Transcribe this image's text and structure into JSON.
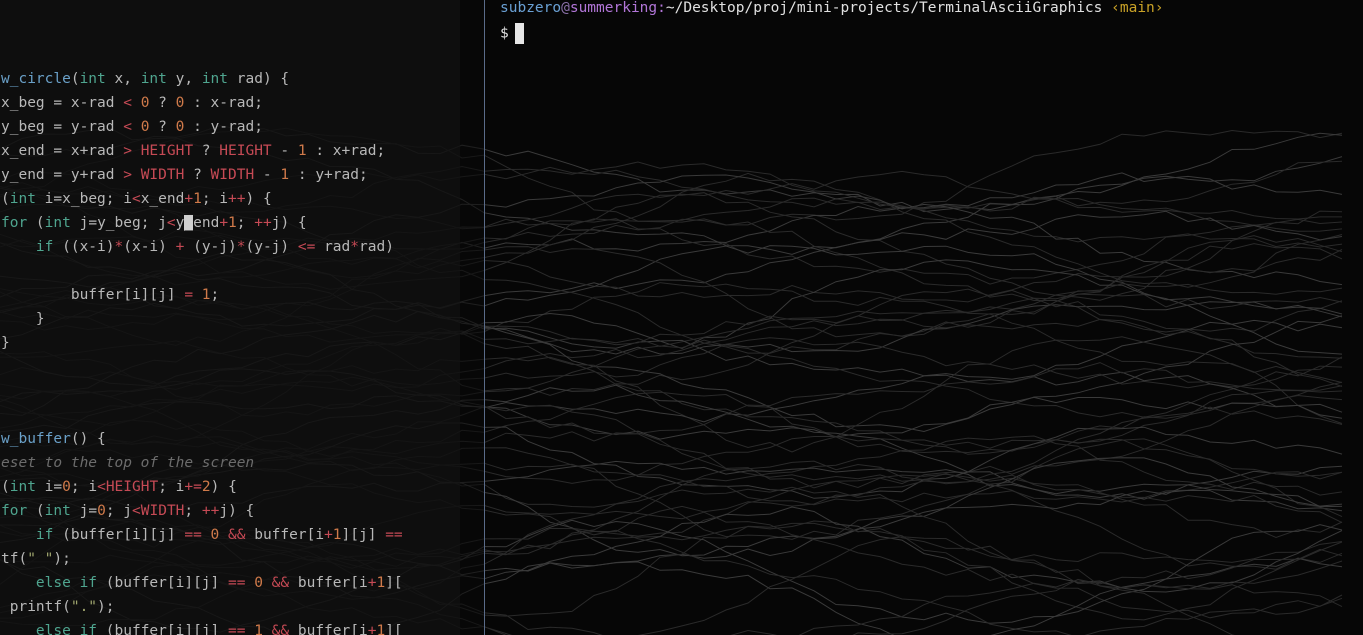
{
  "editor": {
    "lines": [
      [
        [
          "f",
          "w_circle"
        ],
        [
          "p",
          "("
        ],
        [
          "k",
          "int"
        ],
        [
          "p",
          " x, "
        ],
        [
          "k",
          "int"
        ],
        [
          "p",
          " y, "
        ],
        [
          "k",
          "int"
        ],
        [
          "p",
          " rad) {"
        ]
      ],
      [
        [
          "p",
          "x_beg = x-rad "
        ],
        [
          "o",
          "<"
        ],
        [
          "p",
          " "
        ],
        [
          "n",
          "0"
        ],
        [
          "p",
          " ? "
        ],
        [
          "n",
          "0"
        ],
        [
          "p",
          " : x-rad;"
        ]
      ],
      [
        [
          "p",
          "y_beg = y-rad "
        ],
        [
          "o",
          "<"
        ],
        [
          "p",
          " "
        ],
        [
          "n",
          "0"
        ],
        [
          "p",
          " ? "
        ],
        [
          "n",
          "0"
        ],
        [
          "p",
          " : y-rad;"
        ]
      ],
      [
        [
          "p",
          "x_end = x+rad "
        ],
        [
          "o",
          ">"
        ],
        [
          "p",
          " "
        ],
        [
          "m",
          "HEIGHT"
        ],
        [
          "p",
          " ? "
        ],
        [
          "m",
          "HEIGHT"
        ],
        [
          "p",
          " - "
        ],
        [
          "n",
          "1"
        ],
        [
          "p",
          " : x+rad;"
        ]
      ],
      [
        [
          "p",
          "y_end = y+rad "
        ],
        [
          "o",
          ">"
        ],
        [
          "p",
          " "
        ],
        [
          "m",
          "WIDTH"
        ],
        [
          "p",
          " ? "
        ],
        [
          "m",
          "WIDTH"
        ],
        [
          "p",
          " - "
        ],
        [
          "n",
          "1"
        ],
        [
          "p",
          " : y+rad;"
        ]
      ],
      [
        [
          "p",
          "("
        ],
        [
          "k",
          "int"
        ],
        [
          "p",
          " i=x_beg; i"
        ],
        [
          "o",
          "<"
        ],
        [
          "p",
          "x_end"
        ],
        [
          "o",
          "+"
        ],
        [
          "n",
          "1"
        ],
        [
          "p",
          "; i"
        ],
        [
          "o",
          "++"
        ],
        [
          "p",
          ") {"
        ]
      ],
      [
        [
          "k",
          "for"
        ],
        [
          "p",
          " ("
        ],
        [
          "k",
          "int"
        ],
        [
          "p",
          " j=y_beg; j"
        ],
        [
          "o",
          "<"
        ],
        [
          "p",
          "y"
        ],
        [
          "cur",
          "_"
        ],
        [
          "p",
          "end"
        ],
        [
          "o",
          "+"
        ],
        [
          "n",
          "1"
        ],
        [
          "p",
          "; "
        ],
        [
          "o",
          "++"
        ],
        [
          "p",
          "j) {"
        ]
      ],
      [
        [
          "p",
          "    "
        ],
        [
          "k",
          "if"
        ],
        [
          "p",
          " ((x-i)"
        ],
        [
          "o",
          "*"
        ],
        [
          "p",
          "(x-i) "
        ],
        [
          "o",
          "+"
        ],
        [
          "p",
          " (y-j)"
        ],
        [
          "o",
          "*"
        ],
        [
          "p",
          "(y-j) "
        ],
        [
          "o",
          "<="
        ],
        [
          "p",
          " rad"
        ],
        [
          "o",
          "*"
        ],
        [
          "p",
          "rad)"
        ]
      ],
      [
        [
          "p",
          ""
        ]
      ],
      [
        [
          "p",
          "        buffer[i][j] "
        ],
        [
          "o",
          "="
        ],
        [
          "p",
          " "
        ],
        [
          "n",
          "1"
        ],
        [
          "p",
          ";"
        ]
      ],
      [
        [
          "p",
          "    }"
        ]
      ],
      [
        [
          "p",
          "}"
        ]
      ],
      [
        [
          "p",
          ""
        ]
      ],
      [
        [
          "p",
          ""
        ]
      ],
      [
        [
          "p",
          ""
        ]
      ],
      [
        [
          "f",
          "w_buffer"
        ],
        [
          "p",
          "() {"
        ]
      ],
      [
        [
          "c",
          "eset to the top of the screen"
        ]
      ],
      [
        [
          "p",
          "("
        ],
        [
          "k",
          "int"
        ],
        [
          "p",
          " i="
        ],
        [
          "n",
          "0"
        ],
        [
          "p",
          "; i"
        ],
        [
          "o",
          "<"
        ],
        [
          "m",
          "HEIGHT"
        ],
        [
          "p",
          "; i"
        ],
        [
          "o",
          "+="
        ],
        [
          "n",
          "2"
        ],
        [
          "p",
          ") {"
        ]
      ],
      [
        [
          "k",
          "for"
        ],
        [
          "p",
          " ("
        ],
        [
          "k",
          "int"
        ],
        [
          "p",
          " j="
        ],
        [
          "n",
          "0"
        ],
        [
          "p",
          "; j"
        ],
        [
          "o",
          "<"
        ],
        [
          "m",
          "WIDTH"
        ],
        [
          "p",
          "; "
        ],
        [
          "o",
          "++"
        ],
        [
          "p",
          "j) {"
        ]
      ],
      [
        [
          "p",
          "    "
        ],
        [
          "k",
          "if"
        ],
        [
          "p",
          " (buffer[i][j] "
        ],
        [
          "o",
          "=="
        ],
        [
          "p",
          " "
        ],
        [
          "n",
          "0"
        ],
        [
          "p",
          " "
        ],
        [
          "o",
          "&&"
        ],
        [
          "p",
          " buffer[i"
        ],
        [
          "o",
          "+"
        ],
        [
          "n",
          "1"
        ],
        [
          "p",
          "][j] "
        ],
        [
          "o",
          "=="
        ]
      ],
      [
        [
          "p",
          "tf("
        ],
        [
          "s",
          "\" \""
        ],
        [
          "p",
          ");"
        ]
      ],
      [
        [
          "p",
          "    "
        ],
        [
          "k",
          "else"
        ],
        [
          "p",
          " "
        ],
        [
          "k",
          "if"
        ],
        [
          "p",
          " (buffer[i][j] "
        ],
        [
          "o",
          "=="
        ],
        [
          "p",
          " "
        ],
        [
          "n",
          "0"
        ],
        [
          "p",
          " "
        ],
        [
          "o",
          "&&"
        ],
        [
          "p",
          " buffer[i"
        ],
        [
          "o",
          "+"
        ],
        [
          "n",
          "1"
        ],
        [
          "p",
          "]["
        ]
      ],
      [
        [
          "p",
          " printf("
        ],
        [
          "s",
          "\".\""
        ],
        [
          "p",
          ");"
        ]
      ],
      [
        [
          "p",
          "    "
        ],
        [
          "k",
          "else"
        ],
        [
          "p",
          " "
        ],
        [
          "k",
          "if"
        ],
        [
          "p",
          " (buffer[i][j] "
        ],
        [
          "o",
          "=="
        ],
        [
          "p",
          " "
        ],
        [
          "n",
          "1"
        ],
        [
          "p",
          " "
        ],
        [
          "o",
          "&&"
        ],
        [
          "p",
          " buffer[i"
        ],
        [
          "o",
          "+"
        ],
        [
          "n",
          "1"
        ],
        [
          "p",
          "]["
        ]
      ]
    ]
  },
  "terminal": {
    "user": "subzero",
    "at": "@",
    "host": "summerking",
    "colon": ":",
    "path": "~/Desktop/proj/mini-projects/TerminalAsciiGraphics",
    "branch": "‹main›",
    "prompt_symbol": "$"
  },
  "colors": {
    "divider": "#5a6b88",
    "user": "#6aa0d4",
    "host": "#b276d8",
    "branch": "#c9a227"
  }
}
